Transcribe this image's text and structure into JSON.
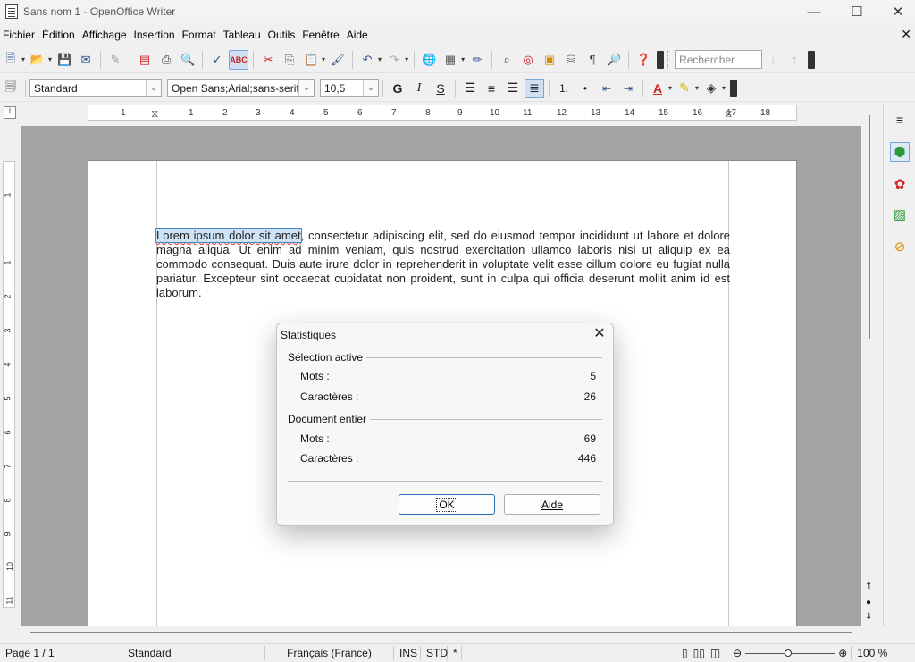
{
  "window": {
    "title": "Sans nom 1 - OpenOffice Writer",
    "minimize": "—",
    "maximize": "☐",
    "close": "✕"
  },
  "menu": {
    "items": [
      "Fichier",
      "Édition",
      "Affichage",
      "Insertion",
      "Format",
      "Tableau",
      "Outils",
      "Fenêtre",
      "Aide"
    ],
    "close_doc": "✕"
  },
  "toolbar_standard": {
    "search_placeholder": "Rechercher"
  },
  "toolbar_format": {
    "paragraph_style": "Standard",
    "font_name": "Open Sans;Arial;sans-serif",
    "font_size": "10,5",
    "bold": "G",
    "italic": "I",
    "underline": "S"
  },
  "ruler": {
    "ticks": [
      "1",
      "1",
      "2",
      "3",
      "4",
      "5",
      "6",
      "7",
      "8",
      "9",
      "10",
      "11",
      "12",
      "13",
      "14",
      "15",
      "16",
      "17",
      "18"
    ],
    "vticks": [
      "1",
      "1",
      "2",
      "3",
      "4",
      "5",
      "6",
      "7",
      "8",
      "9",
      "10",
      "11"
    ]
  },
  "document": {
    "selected_text": "Lorem ipsum dolor sit amet",
    "rest_text": ", consectetur adipiscing elit, sed do eiusmod tempor incididunt ut labore et dolore magna aliqua. Ut enim ad minim veniam, quis nostrud exercitation ullamco laboris nisi ut aliquip ex ea commodo consequat. Duis aute irure dolor in reprehenderit in voluptate velit esse cillum dolore eu fugiat nulla pariatur. Excepteur sint occaecat cupidatat non proident, sunt in culpa qui officia deserunt mollit anim id est laborum."
  },
  "dialog": {
    "title": "Statistiques",
    "close": "✕",
    "selection": {
      "label": "Sélection active",
      "words_label": "Mots :",
      "words": "5",
      "chars_label": "Caractères :",
      "chars": "26"
    },
    "document": {
      "label": "Document entier",
      "words_label": "Mots :",
      "words": "69",
      "chars_label": "Caractères :",
      "chars": "446"
    },
    "ok": "OK",
    "help": "Aide"
  },
  "statusbar": {
    "page": "Page 1 / 1",
    "style": "Standard",
    "language": "Français (France)",
    "insert_mode": "INS",
    "selection_mode": "STD",
    "modified": "*",
    "zoom": "100 %"
  },
  "colors": {
    "selection": "#cde3f7",
    "accent": "#2c69b5",
    "spellcheck": "#dd3333"
  }
}
